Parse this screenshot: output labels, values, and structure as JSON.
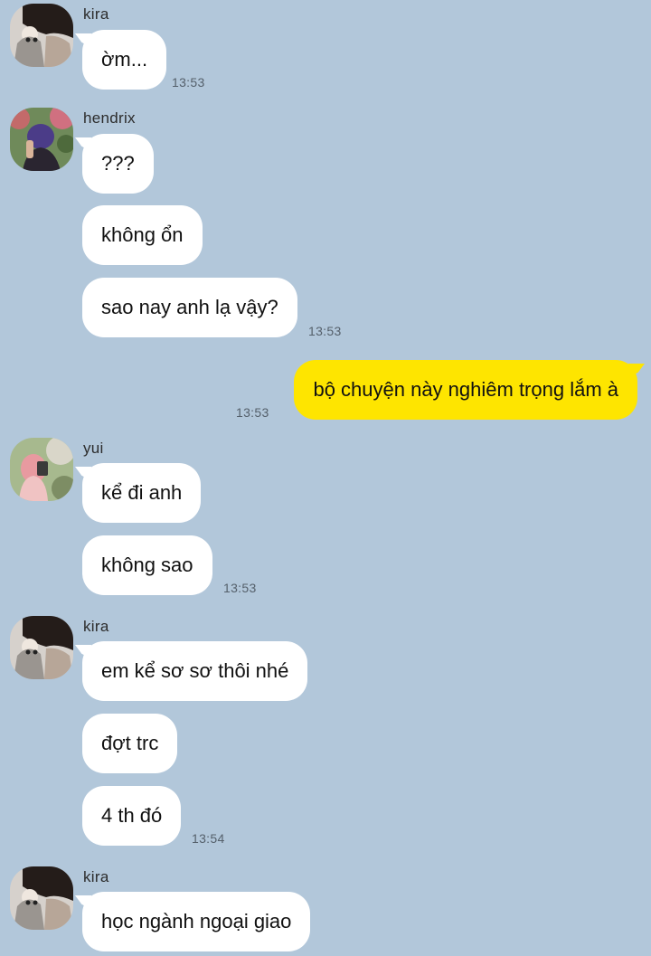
{
  "colors": {
    "background": "#b2c7da",
    "bubble_incoming": "#ffffff",
    "bubble_outgoing": "#fee500",
    "timestamp": "#55606b"
  },
  "messages": [
    {
      "sender": "kira",
      "avatar": "kira-avatar-icon",
      "lines": [
        "ờm..."
      ],
      "time": "13:53"
    },
    {
      "sender": "hendrix",
      "avatar": "hendrix-avatar-icon",
      "lines": [
        "???",
        "không ổn",
        "sao nay anh lạ vậy?"
      ],
      "time": "13:53"
    },
    {
      "sender": "me",
      "lines": [
        "bộ chuyện này nghiêm trọng lắm à"
      ],
      "time": "13:53"
    },
    {
      "sender": "yui",
      "avatar": "yui-avatar-icon",
      "lines": [
        "kể đi anh",
        "không sao"
      ],
      "time": "13:53"
    },
    {
      "sender": "kira",
      "avatar": "kira-avatar-icon",
      "lines": [
        "em kể sơ sơ thôi nhé",
        "đợt trc",
        "4 th đó"
      ],
      "time": "13:54"
    },
    {
      "sender": "kira",
      "avatar": "kira-avatar-icon",
      "lines": [
        "học ngành ngoại giao"
      ]
    }
  ]
}
